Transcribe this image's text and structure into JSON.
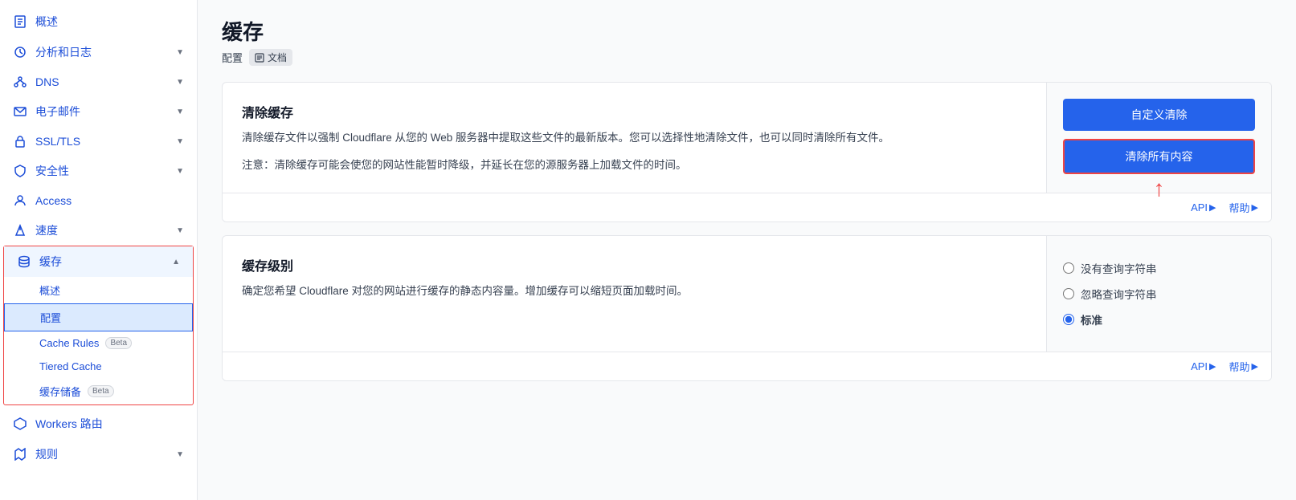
{
  "sidebar": {
    "items": [
      {
        "id": "overview",
        "label": "概述",
        "icon": "doc-icon",
        "hasChevron": false,
        "active": false
      },
      {
        "id": "analytics",
        "label": "分析和日志",
        "icon": "chart-icon",
        "hasChevron": true,
        "active": false
      },
      {
        "id": "dns",
        "label": "DNS",
        "icon": "dns-icon",
        "hasChevron": true,
        "active": false
      },
      {
        "id": "email",
        "label": "电子邮件",
        "icon": "email-icon",
        "hasChevron": true,
        "active": false
      },
      {
        "id": "ssltls",
        "label": "SSL/TLS",
        "icon": "lock-icon",
        "hasChevron": true,
        "active": false
      },
      {
        "id": "security",
        "label": "安全性",
        "icon": "shield-icon",
        "hasChevron": true,
        "active": false
      },
      {
        "id": "access",
        "label": "Access",
        "icon": "access-icon",
        "hasChevron": false,
        "active": false
      },
      {
        "id": "speed",
        "label": "速度",
        "icon": "speed-icon",
        "hasChevron": true,
        "active": false
      },
      {
        "id": "cache",
        "label": "缓存",
        "icon": "cache-icon",
        "hasChevron": true,
        "active": true
      }
    ],
    "cache_subitems": [
      {
        "id": "cache-overview",
        "label": "概述",
        "active": false
      },
      {
        "id": "cache-config",
        "label": "配置",
        "active": true
      },
      {
        "id": "cache-rules",
        "label": "Cache Rules",
        "badge": "Beta",
        "active": false
      },
      {
        "id": "tiered-cache",
        "label": "Tiered Cache",
        "active": false
      },
      {
        "id": "cache-reserve",
        "label": "缓存储备",
        "badge": "Beta",
        "active": false
      }
    ],
    "bottom_items": [
      {
        "id": "workers",
        "label": "Workers 路由",
        "icon": "workers-icon",
        "hasChevron": false
      },
      {
        "id": "rules",
        "label": "规则",
        "icon": "rules-icon",
        "hasChevron": true
      }
    ]
  },
  "page": {
    "title": "缓存",
    "subtitle": "配置",
    "doc_label": "文档"
  },
  "purge_card": {
    "title": "清除缓存",
    "description": "清除缓存文件以强制 Cloudflare 从您的 Web 服务器中提取这些文件的最新版本。您可以选择性地清除文件，也可以同时清除所有文件。",
    "note": "注意：清除缓存可能会使您的网站性能暂时降级，并延长在您的源服务器上加载文件的时间。",
    "btn_custom": "自定义清除",
    "btn_all": "清除所有内容",
    "api_label": "API",
    "help_label": "帮助"
  },
  "cache_level_card": {
    "title": "缓存级别",
    "description": "确定您希望 Cloudflare 对您的网站进行缓存的静态内容量。增加缓存可以缩短页面加载时间。",
    "options": [
      {
        "id": "no-query",
        "label": "没有查询字符串",
        "checked": false
      },
      {
        "id": "ignore-query",
        "label": "忽略查询字符串",
        "checked": false
      },
      {
        "id": "standard",
        "label": "标准",
        "checked": true
      }
    ],
    "api_label": "API",
    "help_label": "帮助"
  }
}
